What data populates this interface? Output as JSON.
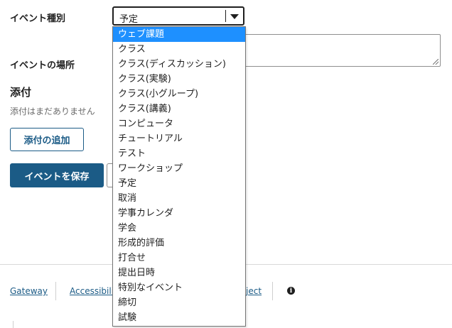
{
  "form": {
    "event_type_label": "イベント種別",
    "event_location_label": "イベントの場所",
    "attachments_title": "添付",
    "no_attachments_text": "添付はまだありません",
    "add_attachment_label": "添付の追加",
    "save_event_label": "イベントを保存"
  },
  "select": {
    "current_value": "予定",
    "options": [
      "ウェブ課題",
      "クラス",
      "クラス(ディスカッション)",
      "クラス(実験)",
      "クラス(小グループ)",
      "クラス(講義)",
      "コンピュータ",
      "チュートリアル",
      "テスト",
      "ワークショップ",
      "予定",
      "取消",
      "学事カレンダ",
      "学会",
      "形成的評価",
      "打合せ",
      "提出日時",
      "特別なイベント",
      "締切",
      "試験"
    ],
    "highlighted_index": 0
  },
  "footer": {
    "gateway_label": "Gateway",
    "accessibility_label": "Accessibilit",
    "project_label": "ject"
  },
  "colors": {
    "primary": "#1b5b86",
    "highlight": "#1e90ff"
  },
  "icons": {
    "info": "info-icon",
    "dropdown_arrow": "chevron-down-icon"
  }
}
